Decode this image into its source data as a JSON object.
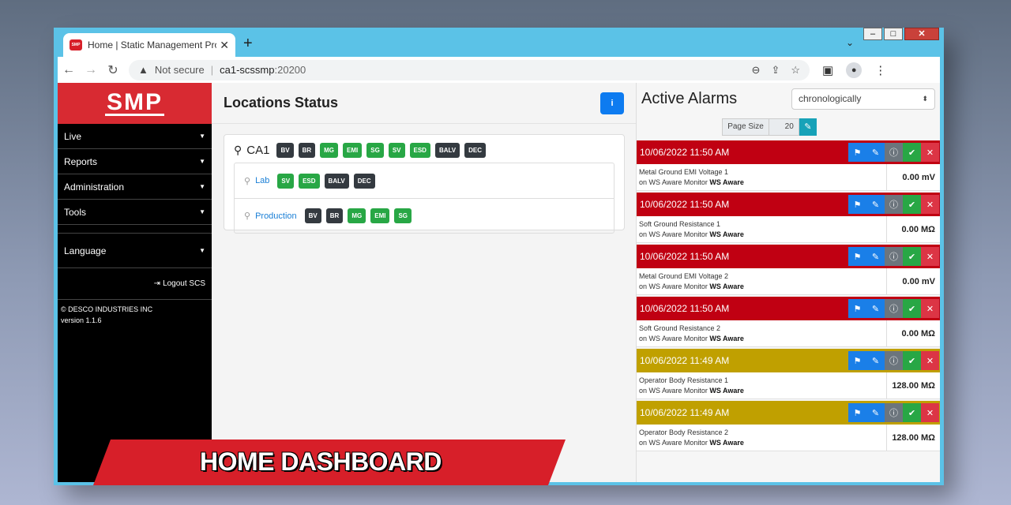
{
  "browser": {
    "tab_title": "Home | Static Management Prog",
    "favicon_text": "SMP",
    "url_warning": "Not secure",
    "url_host": "ca1-scssmp",
    "url_port": ":20200"
  },
  "sidebar": {
    "logo": "SMP",
    "items": [
      {
        "label": "Live"
      },
      {
        "label": "Reports"
      },
      {
        "label": "Administration"
      },
      {
        "label": "Tools"
      },
      {
        "label": "Language"
      }
    ],
    "logout": "Logout SCS",
    "copyright": "© DESCO INDUSTRIES INC",
    "version": "version 1.1.6"
  },
  "locations": {
    "title": "Locations Status",
    "site": {
      "name": "CA1",
      "badges": [
        {
          "text": "BV",
          "status": "dark"
        },
        {
          "text": "BR",
          "status": "dark"
        },
        {
          "text": "MG",
          "status": "green"
        },
        {
          "text": "EMI",
          "status": "green"
        },
        {
          "text": "SG",
          "status": "green"
        },
        {
          "text": "SV",
          "status": "green"
        },
        {
          "text": "ESD",
          "status": "green"
        },
        {
          "text": "BALV",
          "status": "dark"
        },
        {
          "text": "DEC",
          "status": "dark"
        }
      ]
    },
    "sublocations": [
      {
        "name": "Lab",
        "badges": [
          {
            "text": "SV",
            "status": "green"
          },
          {
            "text": "ESD",
            "status": "green"
          },
          {
            "text": "BALV",
            "status": "dark"
          },
          {
            "text": "DEC",
            "status": "dark"
          }
        ]
      },
      {
        "name": "Production",
        "badges": [
          {
            "text": "BV",
            "status": "dark"
          },
          {
            "text": "BR",
            "status": "dark"
          },
          {
            "text": "MG",
            "status": "green"
          },
          {
            "text": "EMI",
            "status": "green"
          },
          {
            "text": "SG",
            "status": "green"
          }
        ]
      }
    ]
  },
  "alarms": {
    "title": "Active Alarms",
    "sort": "chronologically",
    "page_size_label": "Page Size",
    "page_size": "20",
    "items": [
      {
        "time": "10/06/2022 11:50 AM",
        "severity": "red",
        "name": "Metal Ground EMI Voltage 1",
        "monitor_prefix": "on WS Aware Monitor",
        "monitor": "WS Aware",
        "value": "0.00 mV"
      },
      {
        "time": "10/06/2022 11:50 AM",
        "severity": "red",
        "name": "Soft Ground Resistance 1",
        "monitor_prefix": "on WS Aware Monitor",
        "monitor": "WS Aware",
        "value": "0.00 MΩ"
      },
      {
        "time": "10/06/2022 11:50 AM",
        "severity": "red",
        "name": "Metal Ground EMI Voltage 2",
        "monitor_prefix": "on WS Aware Monitor",
        "monitor": "WS Aware",
        "value": "0.00 mV"
      },
      {
        "time": "10/06/2022 11:50 AM",
        "severity": "red",
        "name": "Soft Ground Resistance 2",
        "monitor_prefix": "on WS Aware Monitor",
        "monitor": "WS Aware",
        "value": "0.00 MΩ"
      },
      {
        "time": "10/06/2022 11:49 AM",
        "severity": "yellow",
        "name": "Operator Body Resistance 1",
        "monitor_prefix": "on WS Aware Monitor",
        "monitor": "WS Aware",
        "value": "128.00 MΩ"
      },
      {
        "time": "10/06/2022 11:49 AM",
        "severity": "yellow",
        "name": "Operator Body Resistance 2",
        "monitor_prefix": "on WS Aware Monitor",
        "monitor": "WS Aware",
        "value": "128.00 MΩ"
      }
    ]
  },
  "banner": {
    "text": "HOME DASHBOARD"
  },
  "colors": {
    "brand_red": "#d82a32",
    "alarm_red": "#c00012",
    "alarm_yellow": "#c0a000",
    "ok_green": "#28a745",
    "inactive_dark": "#343a40"
  }
}
